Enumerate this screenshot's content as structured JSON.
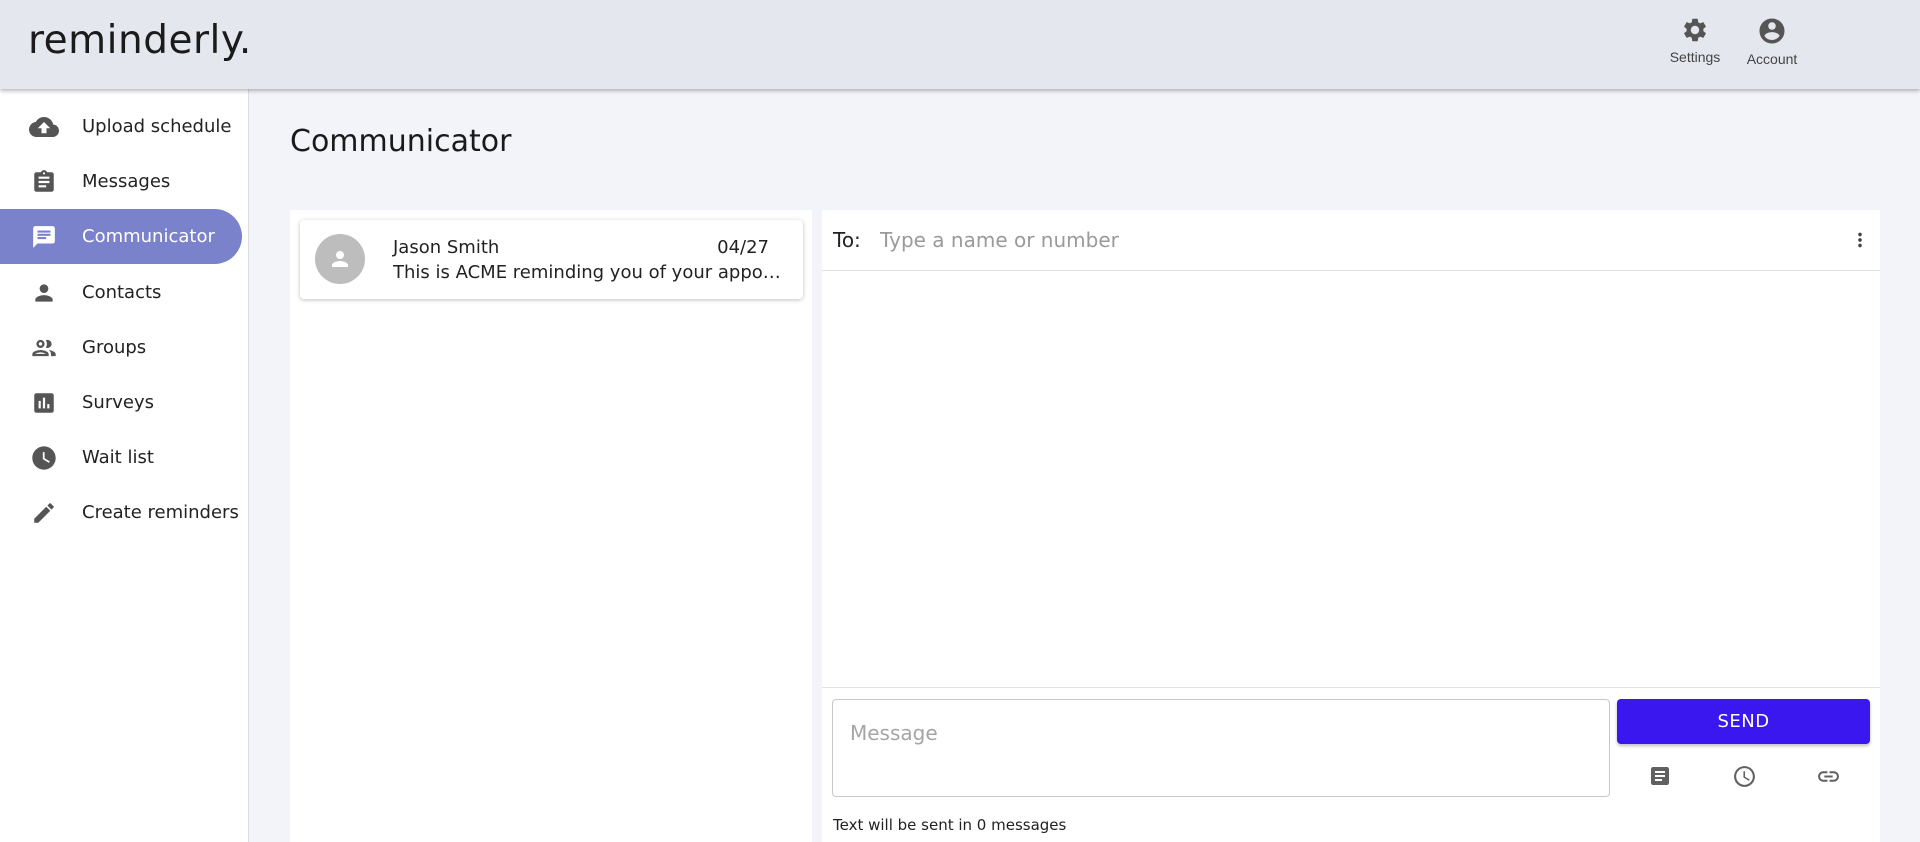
{
  "app": {
    "logo": "reminderly."
  },
  "header": {
    "actions": [
      {
        "label": "Settings",
        "icon": "gear-icon"
      },
      {
        "label": "Account",
        "icon": "account-circle-icon"
      }
    ]
  },
  "sidebar": {
    "items": [
      {
        "label": "Upload schedule",
        "icon": "cloud-upload-icon",
        "active": false
      },
      {
        "label": "Messages",
        "icon": "clipboard-icon",
        "active": false
      },
      {
        "label": "Communicator",
        "icon": "chat-icon",
        "active": true
      },
      {
        "label": "Contacts",
        "icon": "person-icon",
        "active": false
      },
      {
        "label": "Groups",
        "icon": "people-icon",
        "active": false
      },
      {
        "label": "Surveys",
        "icon": "bar-chart-icon",
        "active": false
      },
      {
        "label": "Wait list",
        "icon": "clock-icon",
        "active": false
      },
      {
        "label": "Create reminders",
        "icon": "pencil-icon",
        "active": false
      }
    ]
  },
  "page": {
    "title": "Communicator"
  },
  "conversations": [
    {
      "name": "Jason Smith",
      "date": "04/27",
      "preview": "This is ACME reminding you of your appointment"
    }
  ],
  "compose": {
    "to_label": "To:",
    "to_placeholder": "Type a name or number",
    "to_value": "",
    "message_placeholder": "Message",
    "message_value": "",
    "send_label": "SEND",
    "message_count_text": "Text will be sent in 0 messages",
    "tools": [
      "template-icon",
      "schedule-clock-icon",
      "link-icon"
    ]
  },
  "colors": {
    "header_bg": "#e5e7ef",
    "active_nav": "#7a82cb",
    "send_button": "#3a17ee",
    "page_bg": "#f3f4f9"
  }
}
